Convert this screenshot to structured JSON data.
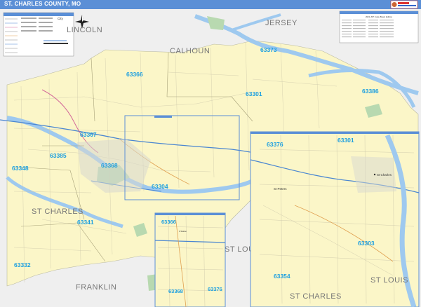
{
  "header": {
    "title": "ST. CHARLES COUNTY, MO"
  },
  "edition": "2021 ZIP Code Basic Edition",
  "counties": [
    "LINCOLN",
    "CALHOUN",
    "JERSEY",
    "ST CHARLES",
    "FRANKLIN",
    "ST LOUIS",
    "ST CHARLES",
    "ST LOUIS"
  ],
  "zips": [
    "63366",
    "63373",
    "63301",
    "63386",
    "63367",
    "63385",
    "63348",
    "63368",
    "63304",
    "63341",
    "63332",
    "63376",
    "63301",
    "63303",
    "63354",
    "63366",
    "63368",
    "63376"
  ],
  "cities": [
    "St Peters",
    "St Charles",
    "O'Fallon",
    "City"
  ],
  "colors": {
    "land": "#fbf6c8",
    "water": "#9ec9ef",
    "zip_label": "#1d9fe0",
    "title_bar": "#5b8fd6"
  }
}
